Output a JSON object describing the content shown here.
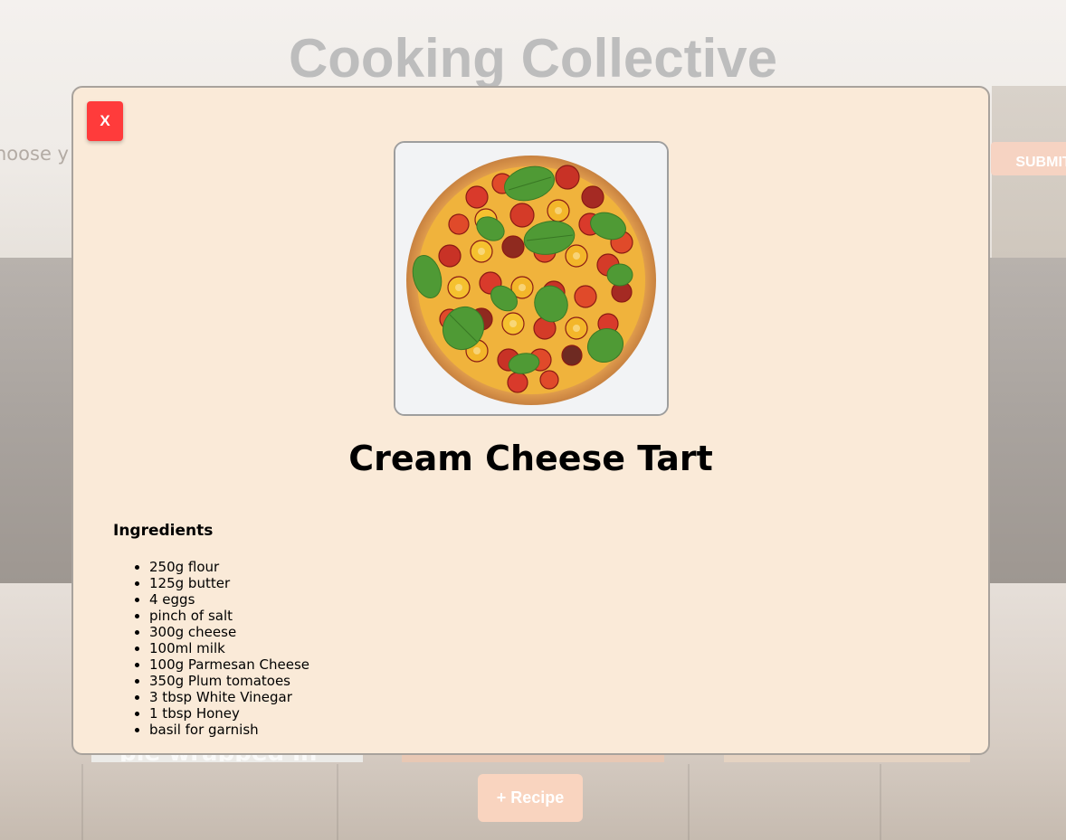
{
  "app": {
    "title": "Cooking Collective",
    "choose_text": "hoose y",
    "submit_label": "SUBMIT",
    "add_recipe_label": "+ Recipe",
    "background_card_text": "pie wrapped in"
  },
  "modal": {
    "close_label": "X",
    "recipe_title": "Cream Cheese Tart",
    "image_icon": "tomato-basil-tart-photo",
    "ingredients_heading": "Ingredients",
    "ingredients": [
      "250g flour",
      "125g butter",
      "4 eggs",
      "pinch of salt",
      "300g cheese",
      "100ml milk",
      "100g Parmesan Cheese",
      "350g Plum tomatoes",
      "3 tbsp White Vinegar",
      "1 tbsp Honey",
      "basil for garnish"
    ]
  },
  "colors": {
    "modal_background": "#faead8",
    "close_button": "#ff3b3b",
    "accent_peach": "#f9d4bf"
  }
}
